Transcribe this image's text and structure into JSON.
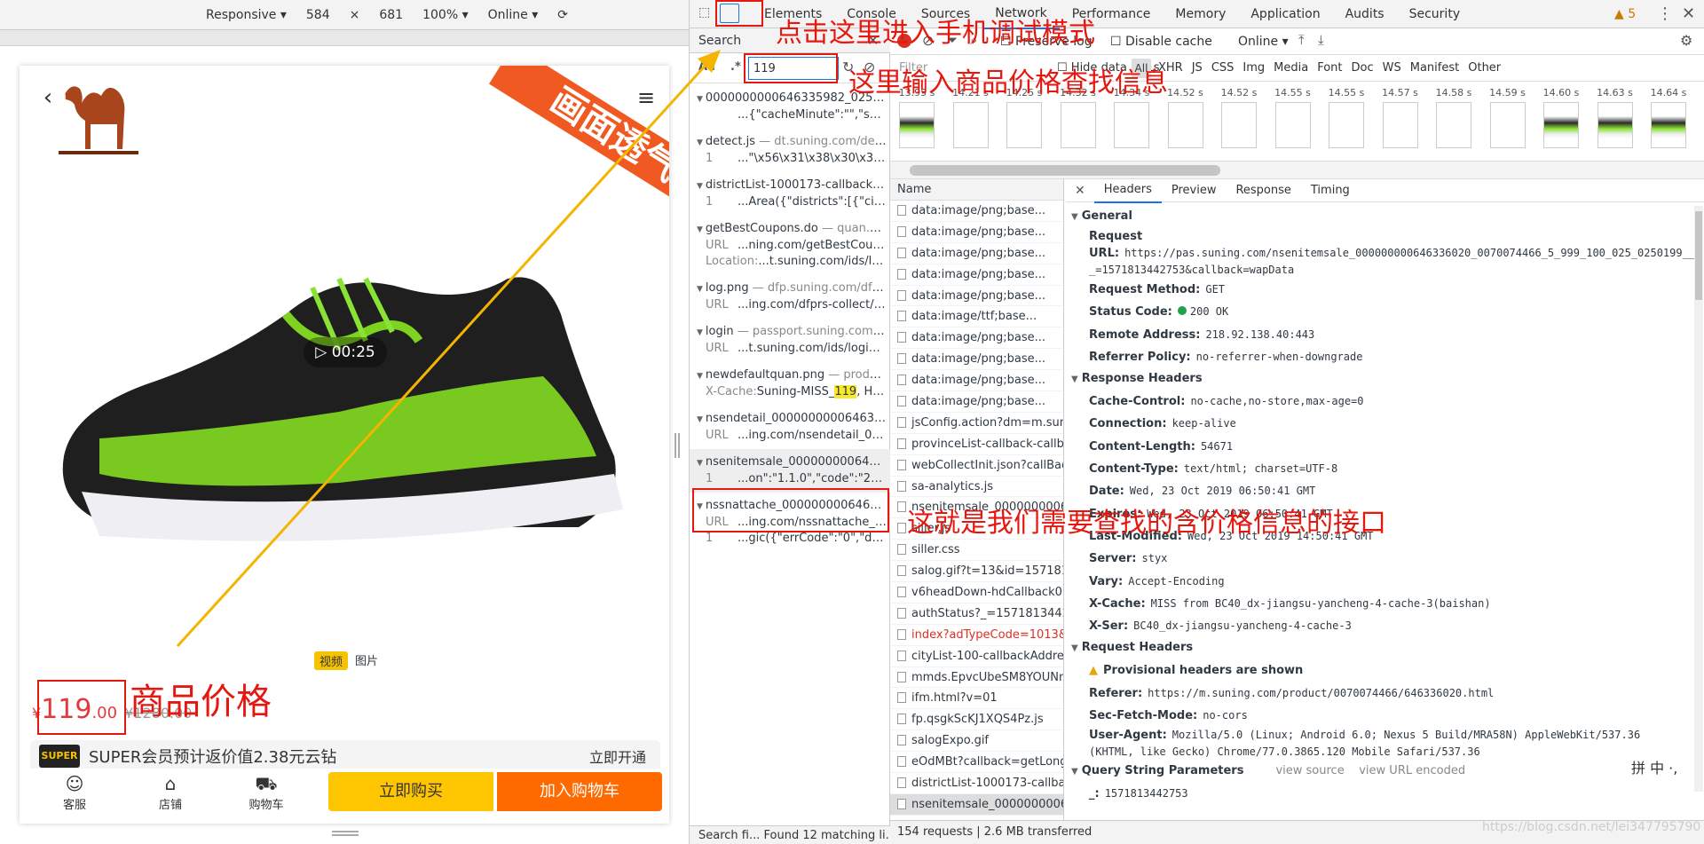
{
  "device_toolbar": {
    "mode": "Responsive ▾",
    "width": "584",
    "x": "×",
    "height": "681",
    "zoom": "100% ▾",
    "network": "Online ▾",
    "rotate_icon": "rotate-icon"
  },
  "phone": {
    "banner": "画面透气",
    "video_duration": "00:25",
    "media_tabs": [
      "视频",
      "图片"
    ],
    "price_symbol": "¥",
    "price_main": "119",
    "price_decimal": ".00",
    "price_old": "¥1280.00",
    "super_badge": "SUPER",
    "super_text": "SUPER会员预计返价值2.38元云钻",
    "super_open": "立即开通",
    "bottom_icons": [
      {
        "label": "客服",
        "icon": "customer-service-icon"
      },
      {
        "label": "店铺",
        "icon": "store-icon"
      },
      {
        "label": "购物车",
        "icon": "cart-icon"
      }
    ],
    "buy_now": "立即购买",
    "add_cart": "加入购物车"
  },
  "devtools": {
    "tabs": [
      "Elements",
      "Console",
      "Sources",
      "Network",
      "Performance",
      "Memory",
      "Application",
      "Audits",
      "Security"
    ],
    "active_tab": "Network",
    "warnings": "▲ 5"
  },
  "search": {
    "title": "Search",
    "aa": "Aa",
    "regex": ".*",
    "query": "119",
    "results": [
      {
        "file": "0000000000646335982_025_0250...",
        "domain": "",
        "lines": [
          [
            "",
            "...{\"cacheMinute\":\"\",\"saleInfo\":[..."
          ]
        ]
      },
      {
        "file": "detect.js",
        "domain": " — dt.suning.com/detect...",
        "lines": [
          [
            "1",
            "...\"\\x56\\x31\\x38\\x30\\x39\\x30\\..."
          ]
        ]
      },
      {
        "file": "districtList-1000173-callbackAddr...",
        "domain": "",
        "lines": [
          [
            "1",
            "...Area({\"districts\":[{\"cityLesId\":..."
          ]
        ]
      },
      {
        "file": "getBestCoupons.do",
        "domain": " — quan.suni...",
        "lines": [
          [
            "URL",
            "...ning.com/getBestCoupon..."
          ],
          [
            "Location:",
            "...t.suning.com/ids/log..."
          ]
        ]
      },
      {
        "file": "log.png",
        "domain": " — dfp.suning.com/dfprs...",
        "lines": [
          [
            "URL",
            "...ing.com/dfprs-collect/fp/l..."
          ]
        ]
      },
      {
        "file": "login",
        "domain": " — passport.suning.com/ids...",
        "lines": [
          [
            "URL",
            "...t.suning.com/ids/login?se..."
          ]
        ]
      },
      {
        "file": "newdefaultquan.png",
        "domain": " — product....",
        "lines": [
          [
            "X-Cache:",
            "Suning-MISS_",
            "119",
            ", HIT ..."
          ]
        ]
      },
      {
        "file": "nsendetail_0000000000646336020...",
        "domain": "",
        "lines": [
          [
            "URL",
            "...ing.com/nsendetail_0000..."
          ]
        ]
      },
      {
        "file": "nsenitemsale_000000000646336...",
        "domain": "",
        "lines": [
          [
            "1",
            "...on\":\"1.1.0\",\"code\":\"200\",\"dat..."
          ]
        ]
      },
      {
        "file": "nssnattache_0000000006463360...",
        "domain": "",
        "lines": [
          [
            "URL",
            "...ing.com/nssnattache_000..."
          ],
          [
            "1",
            "...gic({\"errCode\":\"0\",\"data\":{\"su..."
          ]
        ]
      }
    ],
    "status": "Search fi...  Found 12 matching li..."
  },
  "network": {
    "preserve_log": "Preserve log",
    "disable_cache": "Disable cache",
    "throttle": "Online ▾",
    "filter_placeholder": "Filter",
    "hide_urls": "Hide data URLs",
    "all": "All",
    "type_filters": [
      "XHR",
      "JS",
      "CSS",
      "Img",
      "Media",
      "Font",
      "Doc",
      "WS",
      "Manifest",
      "Other"
    ],
    "filmstrip": [
      {
        "t": "13.95 s",
        "shoe": true
      },
      {
        "t": "14.21 s",
        "shoe": false
      },
      {
        "t": "14.25 s",
        "shoe": false
      },
      {
        "t": "14.32 s",
        "shoe": false
      },
      {
        "t": "14.34 s",
        "shoe": false
      },
      {
        "t": "14.52 s",
        "shoe": false
      },
      {
        "t": "14.52 s",
        "shoe": false
      },
      {
        "t": "14.55 s",
        "shoe": false
      },
      {
        "t": "14.55 s",
        "shoe": false
      },
      {
        "t": "14.57 s",
        "shoe": false
      },
      {
        "t": "14.58 s",
        "shoe": false
      },
      {
        "t": "14.59 s",
        "shoe": false
      },
      {
        "t": "14.60 s",
        "shoe": true
      },
      {
        "t": "14.63 s",
        "shoe": true
      },
      {
        "t": "14.64 s",
        "shoe": true
      }
    ],
    "name_header": "Name",
    "requests": [
      {
        "name": "data:image/png;base...",
        "state": ""
      },
      {
        "name": "data:image/png;base...",
        "state": ""
      },
      {
        "name": "data:image/png;base...",
        "state": ""
      },
      {
        "name": "data:image/png;base...",
        "state": ""
      },
      {
        "name": "data:image/png;base...",
        "state": ""
      },
      {
        "name": "data:image/ttf;base...",
        "state": ""
      },
      {
        "name": "data:image/png;base...",
        "state": ""
      },
      {
        "name": "data:image/png;base...",
        "state": ""
      },
      {
        "name": "data:image/png;base...",
        "state": ""
      },
      {
        "name": "data:image/png;base...",
        "state": ""
      },
      {
        "name": "jsConfig.action?dm=m.sunin",
        "state": ""
      },
      {
        "name": "provinceList-callback-callbac",
        "state": ""
      },
      {
        "name": "webCollectInit.json?callBack.",
        "state": ""
      },
      {
        "name": "sa-analytics.js",
        "state": ""
      },
      {
        "name": "nsenitemsale_0000000006463",
        "state": ""
      },
      {
        "name": "siller.js",
        "state": ""
      },
      {
        "name": "siller.css",
        "state": ""
      },
      {
        "name": "salog.gif?t=13&id=1571813",
        "state": ""
      },
      {
        "name": "v6headDown-hdCallback0.js",
        "state": ""
      },
      {
        "name": "authStatus?_=15718134425",
        "state": ""
      },
      {
        "name": "index?adTypeCode=1013&a",
        "state": "err"
      },
      {
        "name": "cityList-100-callbackAddress",
        "state": ""
      },
      {
        "name": "mmds.EpvcUbeSM8YOUNm.",
        "state": ""
      },
      {
        "name": "ifm.html?v=01",
        "state": ""
      },
      {
        "name": "fp.qsgkScKJ1XQS4Pz.js",
        "state": ""
      },
      {
        "name": "salogExpo.gif",
        "state": ""
      },
      {
        "name": "eOdMBt?callback=getLongU",
        "state": ""
      },
      {
        "name": "districtList-1000173-callback",
        "state": ""
      },
      {
        "name": "nsenitemsale_000000000646",
        "state": "sel"
      }
    ],
    "status": "154 requests  |  2.6 MB transferred"
  },
  "details": {
    "tabs": [
      "Headers",
      "Preview",
      "Response",
      "Timing"
    ],
    "active_tab": "Headers",
    "general_title": "General",
    "general": [
      {
        "k": "Request URL:",
        "v": "https://pas.suning.com/nsenitemsale_000000000646336020_0070074466_5_999_100_025_0250199______1000173_.html?_=1571813442753&callback=wapData",
        "wrap": true
      },
      {
        "k": "Request Method:",
        "v": "GET"
      },
      {
        "k": "Status Code:",
        "v": "200 OK",
        "dot": true
      },
      {
        "k": "Remote Address:",
        "v": "218.92.138.40:443"
      },
      {
        "k": "Referrer Policy:",
        "v": "no-referrer-when-downgrade"
      }
    ],
    "response_title": "Response Headers",
    "response": [
      {
        "k": "Cache-Control:",
        "v": "no-cache,no-store,max-age=0"
      },
      {
        "k": "Connection:",
        "v": "keep-alive"
      },
      {
        "k": "Content-Length:",
        "v": "54671"
      },
      {
        "k": "Content-Type:",
        "v": "text/html; charset=UTF-8"
      },
      {
        "k": "Date:",
        "v": "Wed, 23 Oct 2019 06:50:41 GMT"
      },
      {
        "k": "Expires:",
        "v": "Wed, 23 Oct 2019 06:50:41 GMT"
      },
      {
        "k": "Last-Modified:",
        "v": "Wed, 23 Oct 2019 14:50:41 GMT"
      },
      {
        "k": "Server:",
        "v": "styx"
      },
      {
        "k": "Vary:",
        "v": "Accept-Encoding"
      },
      {
        "k": "X-Cache:",
        "v": "MISS from BC40_dx-jiangsu-yancheng-4-cache-3(baishan)"
      },
      {
        "k": "X-Ser:",
        "v": "BC40_dx-jiangsu-yancheng-4-cache-3"
      }
    ],
    "request_title": "Request Headers",
    "provisional": "Provisional headers are shown",
    "request": [
      {
        "k": "Referer:",
        "v": "https://m.suning.com/product/0070074466/646336020.html"
      },
      {
        "k": "Sec-Fetch-Mode:",
        "v": "no-cors"
      },
      {
        "k": "User-Agent:",
        "v": "Mozilla/5.0 (Linux; Android 6.0; Nexus 5 Build/MRA58N) AppleWebKit/537.36 (KHTML, like Gecko) Chrome/77.0.3865.120 Mobile Safari/537.36",
        "wrap": true
      }
    ],
    "qs_title": "Query String Parameters",
    "qs_view_source": "view source",
    "qs_view_url": "view URL encoded",
    "qs": [
      {
        "k": "_:",
        "v": "1571813442753"
      }
    ]
  },
  "ime": "拼 中 ·,",
  "annotations": {
    "device_mode": "点击这里进入手机调试模式",
    "search_price": "这里输入商品价格查找信息",
    "api_found": "这就是我们需要查找的含价格信息的接口",
    "price_label": "商品价格"
  },
  "watermark": "https://blog.csdn.net/lei347795790",
  "colors": {
    "annotation_red": "#e6170f",
    "price_red": "#e4393c",
    "arrow_yellow": "#f5b400",
    "buy_yellow": "#fec600",
    "cart_orange": "#ff6a00"
  }
}
